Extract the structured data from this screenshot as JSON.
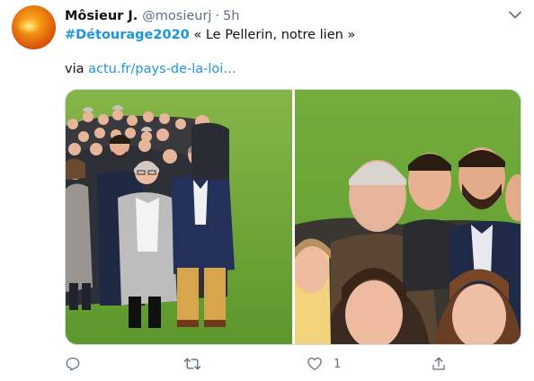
{
  "tweet": {
    "display_name": "Môsieur J.",
    "handle": "@mosieurj",
    "separator": "·",
    "timestamp": "5h",
    "hashtag": "#Détourage2020",
    "quote_text": " « Le Pellerin, notre lien »",
    "via_label": "via ",
    "link_text": "actu.fr/pays-de-la-loi…"
  },
  "media": {
    "left_photo": "group-photo-wide",
    "right_photo": "group-photo-zoom"
  },
  "actions": {
    "reply_icon": "reply-icon",
    "retweet_icon": "retweet-icon",
    "like_icon": "heart-icon",
    "like_count": "1",
    "share_icon": "share-icon"
  },
  "colors": {
    "link": "#1b95e0",
    "muted": "#5b7083",
    "text": "#0f1419"
  }
}
